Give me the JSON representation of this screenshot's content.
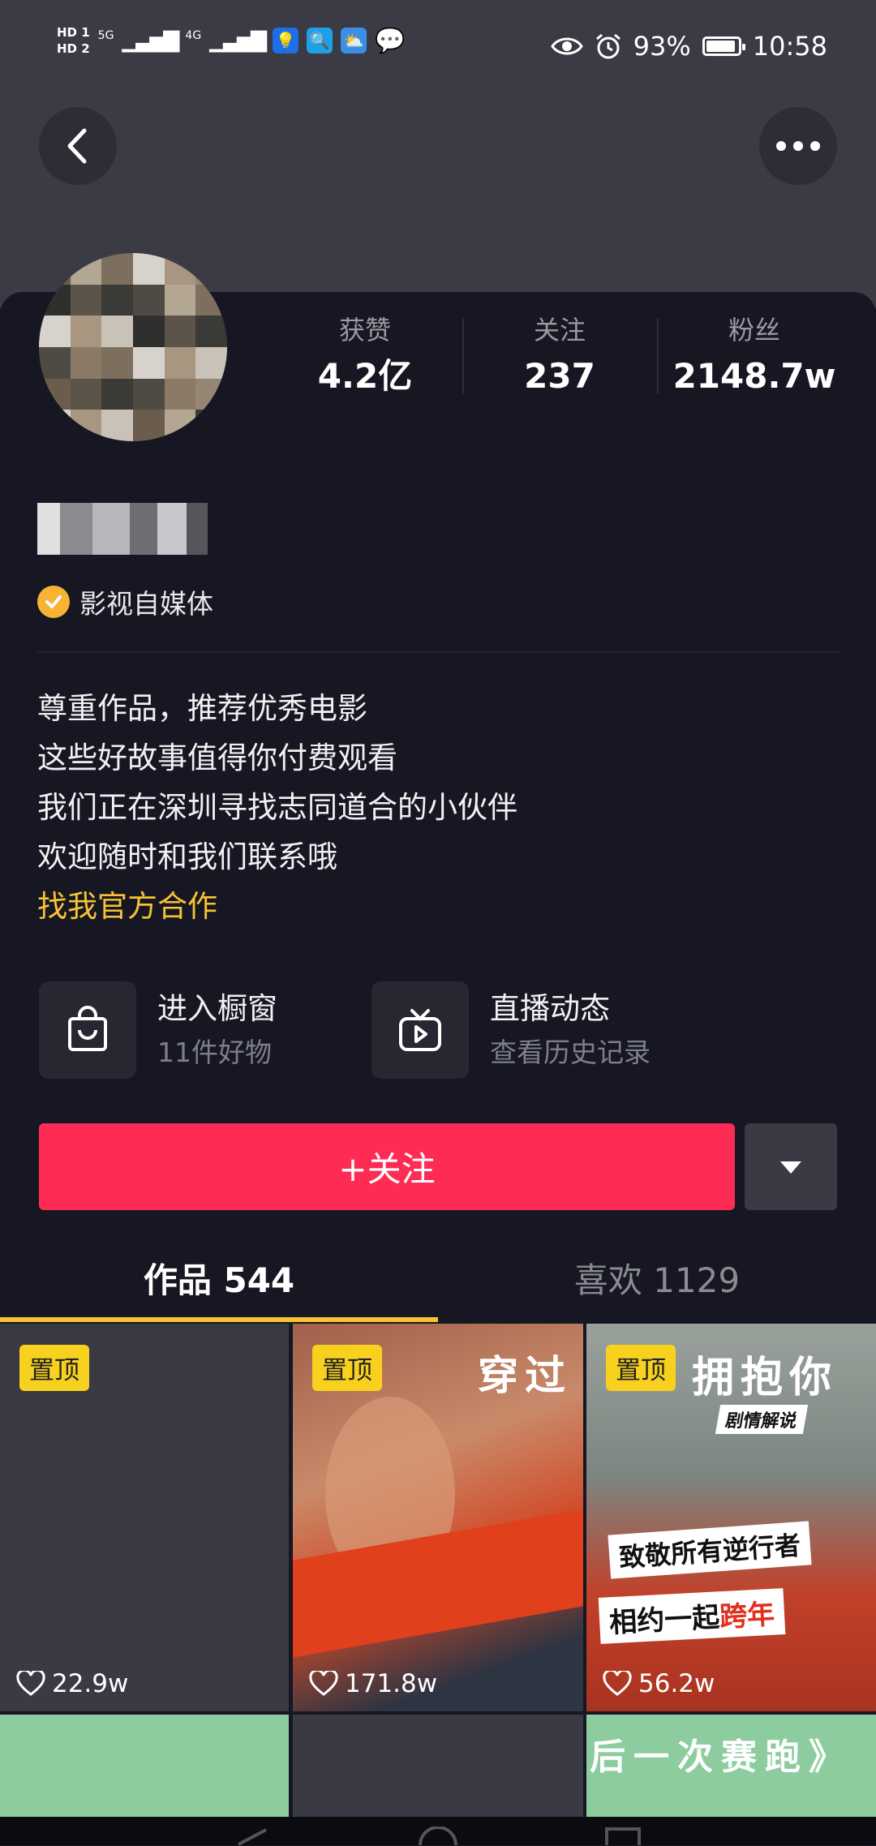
{
  "status_bar": {
    "hd1": "HD 1",
    "hd2": "HD 2",
    "net1": "5G",
    "net2": "4G",
    "battery_pct": "93%",
    "battery_level": 0.93,
    "time": "10:58"
  },
  "profile": {
    "verify_label": "影视自媒体",
    "stats": [
      {
        "label": "获赞",
        "value": "4.2亿"
      },
      {
        "label": "关注",
        "value": "237"
      },
      {
        "label": "粉丝",
        "value": "2148.7w"
      }
    ],
    "bio_lines": [
      "尊重作品，推荐优秀电影",
      "这些好故事值得你付费观看",
      "我们正在深圳寻找志同道合的小伙伴",
      "欢迎随时和我们联系哦"
    ],
    "bio_link": "找我官方合作"
  },
  "features": [
    {
      "title": "进入橱窗",
      "sub": "11件好物",
      "icon": "shopping-bag-icon"
    },
    {
      "title": "直播动态",
      "sub": "查看历史记录",
      "icon": "tv-play-icon"
    }
  ],
  "actions": {
    "follow_label": "+关注"
  },
  "tabs": [
    {
      "label": "作品 544",
      "active": true
    },
    {
      "label": "喜欢 1129",
      "active": false
    }
  ],
  "videos": [
    {
      "pin": "置顶",
      "likes": "22.9w"
    },
    {
      "pin": "置顶",
      "likes": "171.8w",
      "overlay": "穿过"
    },
    {
      "pin": "置顶",
      "likes": "56.2w",
      "overlay_top": "拥抱你",
      "tag": "剧情解说",
      "line1": "致敬所有逆行者",
      "line2a": "相约一起",
      "line2b": "跨年"
    },
    {},
    {},
    {
      "overlay": "后一次赛跑》"
    }
  ],
  "colors": {
    "background": "#161722",
    "follow": "#fe2c55",
    "accent": "#f8c234"
  }
}
